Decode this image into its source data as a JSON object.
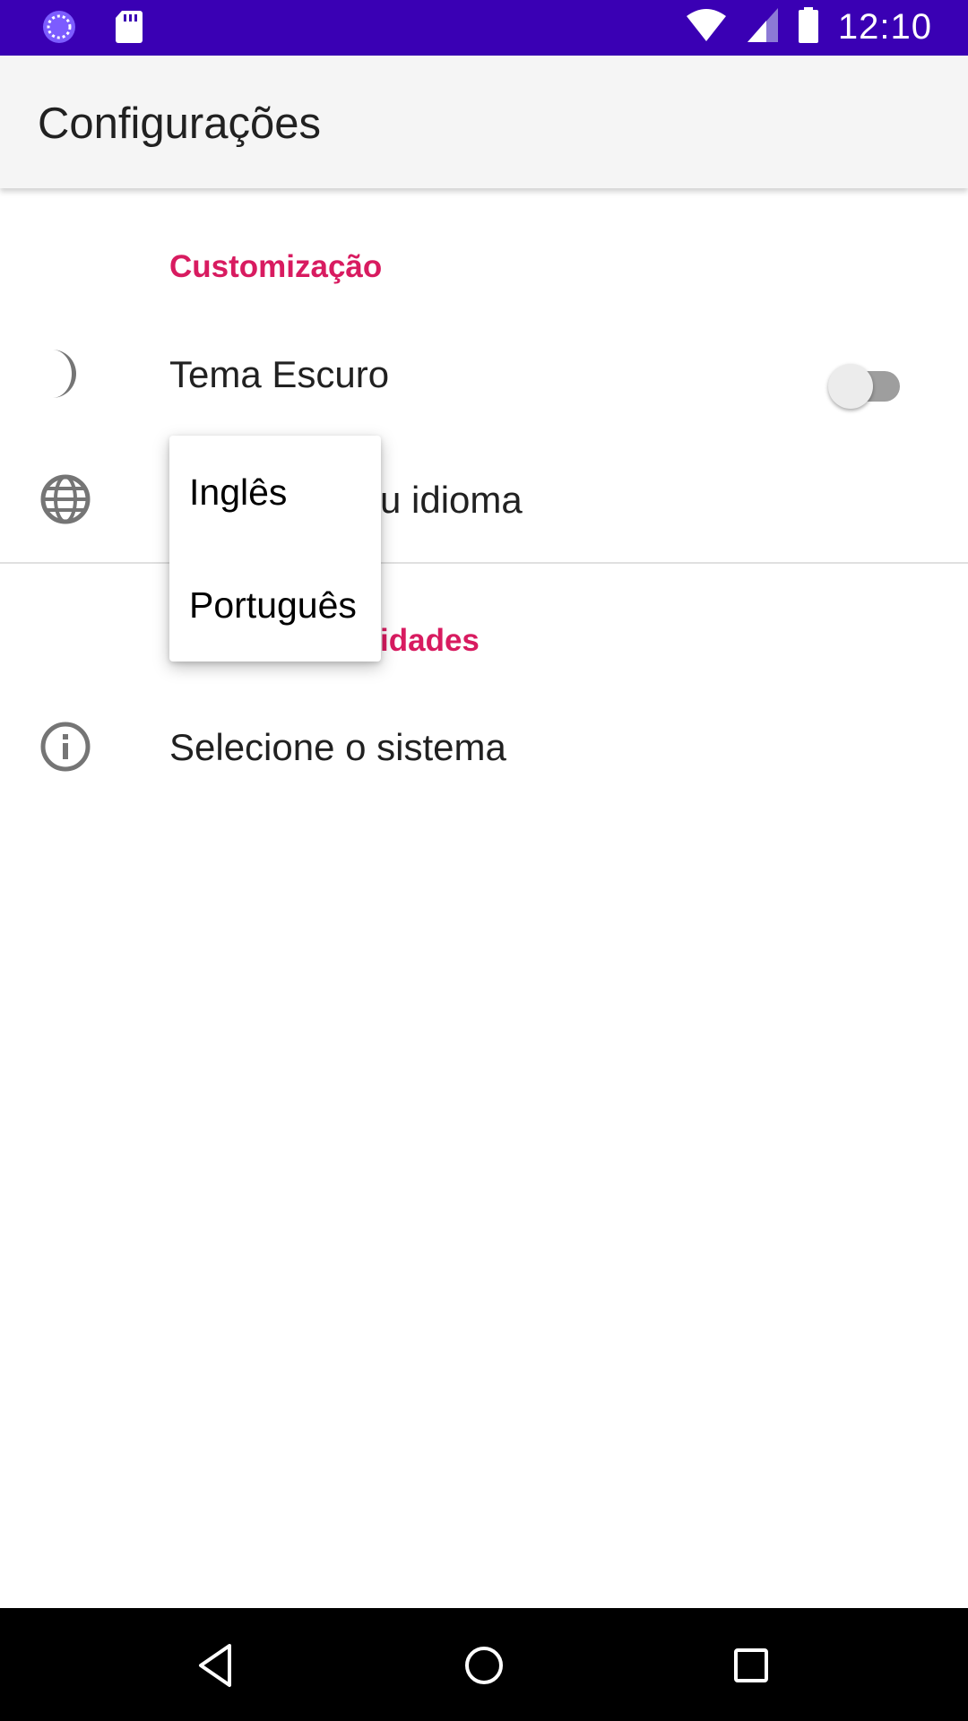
{
  "status_bar": {
    "time": "12:10",
    "left_icons": [
      "sync-icon",
      "sd-card-icon"
    ],
    "right_icons": [
      "wifi-icon",
      "cell-signal-icon",
      "battery-icon"
    ],
    "background_color": "#3a00b4"
  },
  "app_bar": {
    "title": "Configurações"
  },
  "categories": [
    {
      "title": "Customização",
      "items": [
        {
          "title": "Tema Escuro",
          "icon": "moon-icon",
          "widget": "switch",
          "checked": false
        },
        {
          "title": "u idioma",
          "icon": "globe-icon",
          "widget": "list"
        }
      ]
    },
    {
      "title": "idades",
      "items": [
        {
          "title": "Selecione o sistema",
          "icon": "info-icon"
        }
      ]
    }
  ],
  "popup_menu": {
    "options": [
      "Inglês",
      "Português"
    ]
  },
  "nav_bar": {
    "buttons": [
      "back-icon",
      "home-icon",
      "recents-icon"
    ]
  },
  "colors": {
    "accent": "#d81b60",
    "app_bar_bg": "#f5f5f5",
    "icon_gray": "#757575"
  }
}
